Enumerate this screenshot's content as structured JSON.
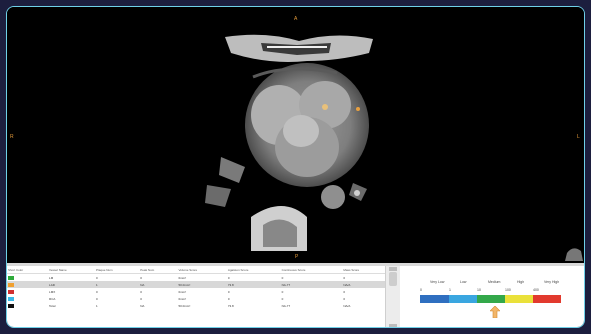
{
  "viewer": {
    "orientation": {
      "top": "A",
      "bottom": "P",
      "left": "R",
      "right": "L"
    }
  },
  "colors": {
    "frame_border": "#6fd0e8",
    "background": "#1c1e3e",
    "orientation_markers": "#e39a3a"
  },
  "table": {
    "headers": [
      "Short Color",
      "Vessel Name",
      "Plaque Num",
      "Peak Num",
      "Volume Score",
      "Agatston Score",
      "Continuous Score",
      "Mass Score"
    ],
    "rows": [
      {
        "color": "#2eaa3a",
        "cells": [
          "",
          "LM",
          "0",
          "0",
          "0mm³",
          "0",
          "0",
          "0"
        ]
      },
      {
        "color": "#f0a030",
        "cells": [
          "",
          "LAD",
          "1",
          "NA",
          "50.0mm³",
          "73.8",
          "NA-77",
          "NA/A"
        ],
        "selected": true
      },
      {
        "color": "#d03030",
        "cells": [
          "",
          "LMX",
          "0",
          "0",
          "0mm³",
          "0",
          "0",
          "0"
        ]
      },
      {
        "color": "#38b8e8",
        "cells": [
          "",
          "RCA",
          "0",
          "0",
          "0mm³",
          "0",
          "0",
          "0"
        ]
      },
      {
        "color": "#111111",
        "cells": [
          "",
          "Total",
          "1",
          "NA",
          "50.0mm³",
          "73.8",
          "NA-77",
          "NA/A"
        ]
      }
    ]
  },
  "scale": {
    "labels": [
      "Very Low",
      "Low",
      "Medium",
      "High",
      "Very High"
    ],
    "ticks": [
      "0",
      "1",
      "10",
      "100",
      "400"
    ],
    "segments": [
      {
        "color": "#2f6fc0"
      },
      {
        "color": "#3aa6e0"
      },
      {
        "color": "#33a84a"
      },
      {
        "color": "#eae13a"
      },
      {
        "color": "#e23a2e"
      }
    ],
    "indicator_color": "#f2b66a"
  }
}
